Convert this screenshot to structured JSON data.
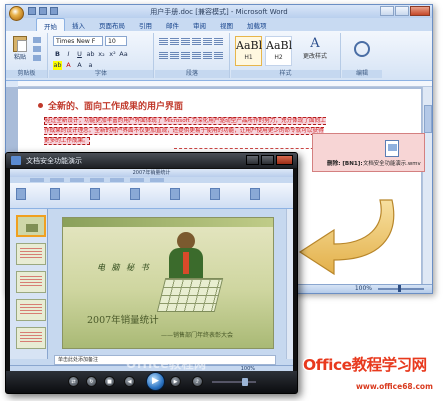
{
  "word": {
    "title": "用户手册.doc [兼容模式] - Microsoft Word",
    "tabs": [
      "开始",
      "插入",
      "页面布局",
      "引用",
      "邮件",
      "审阅",
      "视图",
      "加载项"
    ],
    "ribbon": {
      "paste_label": "粘贴",
      "clipboard_label": "剪贴板",
      "font_name": "Times New F",
      "font_size": "10",
      "font_group_label": "字体",
      "paragraph_label": "段落",
      "styles_label": "样式",
      "editing_label": "编辑",
      "style_h1_sample": "AaBl",
      "style_h1_label": "H1",
      "style_h2_sample": "AaBl",
      "style_h2_label": "H2",
      "change_styles_glyph": "A",
      "change_styles_label": "更改样式"
    },
    "doc": {
      "heading": "全新的、面向工作成果的用户界面",
      "paragraph": "经过全新设计，功能更加丰富的用户界面体现了 Microsoft 为深化用户驱动型产品所作的努力，充分体现了面向工作成果的设计理念。全新的用户界面不仅更加直观，还提供更易于使用的功能，让用户使用更少的命令就可以获得更多的工作成果。",
      "comment_author": "删除: [BN1]:",
      "comment_attachment": "文档安全功能演示.wmv"
    },
    "status": {
      "zoom": "100%"
    }
  },
  "video": {
    "title": "文档安全功能演示",
    "inner_title": "2007年销量统计",
    "slide": {
      "slogan": "电 脑 秘 书",
      "title": "2007年销量统计",
      "subtitle": "——销售部门年终表彰大会"
    },
    "notes": "单击此处添加备注",
    "zoom": "100%",
    "watermark": "Office教程网"
  },
  "brand": {
    "name": "Office教程学习网",
    "url": "www.office68.com"
  },
  "colors": {
    "heading_red": "#c0392b",
    "brand_red": "#e8391d",
    "ribbon_blue": "#dbe7f7"
  }
}
